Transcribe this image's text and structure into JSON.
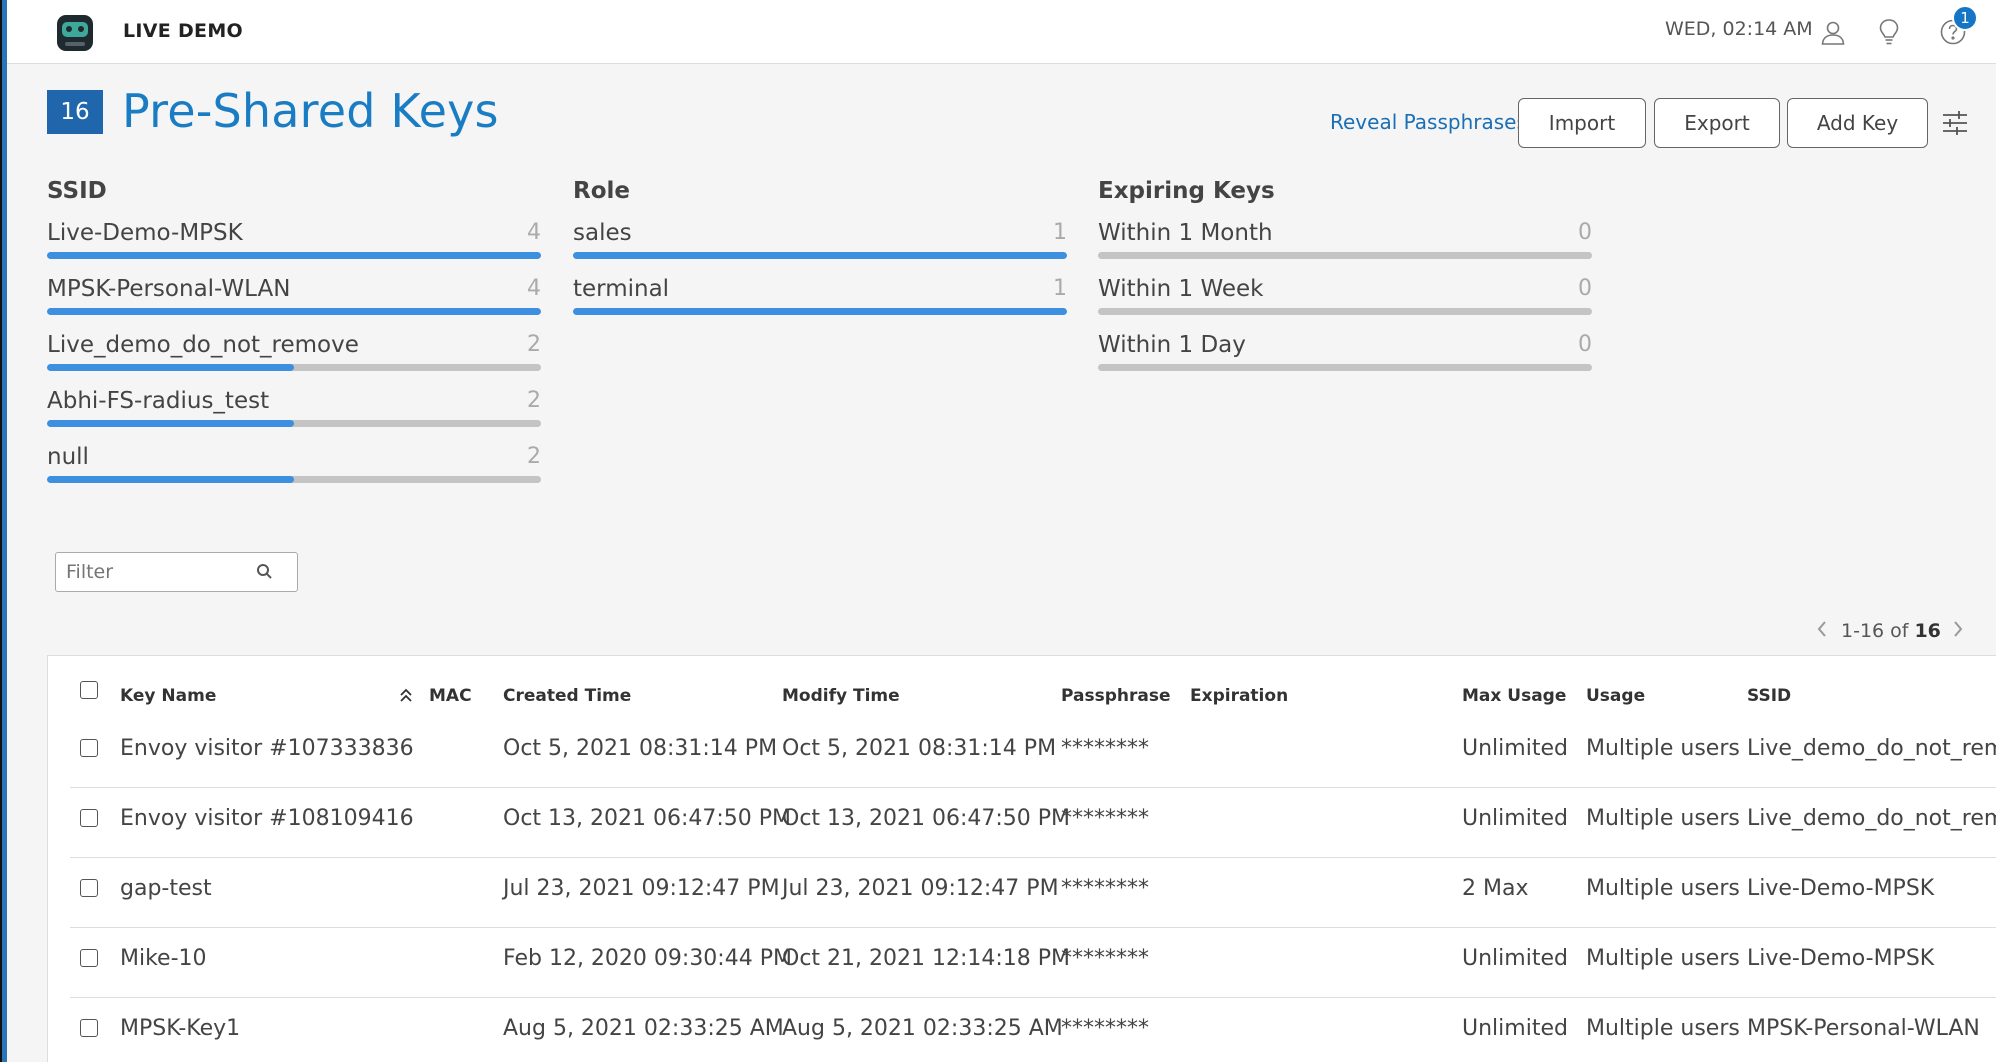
{
  "header": {
    "app_name": "LIVE DEMO",
    "clock": "WED, 02:14 AM",
    "notification_count": "1"
  },
  "page": {
    "count": "16",
    "title": "Pre-Shared Keys",
    "reveal_label": "Reveal Passphrases",
    "import_label": "Import",
    "export_label": "Export",
    "add_key_label": "Add Key"
  },
  "summary": {
    "ssid": {
      "title": "SSID",
      "items": [
        {
          "label": "Live-Demo-MPSK",
          "count": "4",
          "fraction": 1.0
        },
        {
          "label": "MPSK-Personal-WLAN",
          "count": "4",
          "fraction": 1.0
        },
        {
          "label": "Live_demo_do_not_remove",
          "count": "2",
          "fraction": 0.5
        },
        {
          "label": "Abhi-FS-radius_test",
          "count": "2",
          "fraction": 0.5
        },
        {
          "label": "null",
          "count": "2",
          "fraction": 0.5
        }
      ]
    },
    "role": {
      "title": "Role",
      "items": [
        {
          "label": "sales",
          "count": "1",
          "fraction": 1.0
        },
        {
          "label": "terminal",
          "count": "1",
          "fraction": 1.0
        }
      ]
    },
    "expiring": {
      "title": "Expiring Keys",
      "items": [
        {
          "label": "Within 1 Month",
          "count": "0",
          "fraction": 0
        },
        {
          "label": "Within 1 Week",
          "count": "0",
          "fraction": 0
        },
        {
          "label": "Within 1 Day",
          "count": "0",
          "fraction": 0
        }
      ]
    }
  },
  "filter": {
    "placeholder": "Filter"
  },
  "pager": {
    "range": "1-16",
    "of": "of",
    "total": "16"
  },
  "table": {
    "columns": {
      "key_name": "Key Name",
      "mac": "MAC",
      "created": "Created Time",
      "modify": "Modify Time",
      "passphrase": "Passphrase",
      "expiration": "Expiration",
      "max_usage": "Max Usage",
      "usage": "Usage",
      "ssid": "SSID"
    },
    "rows": [
      {
        "key_name": "Envoy visitor #107333836",
        "mac": "",
        "created": "Oct 5, 2021 08:31:14 PM",
        "modify": "Oct 5, 2021 08:31:14 PM",
        "passphrase": "********",
        "expiration": "",
        "max_usage": "Unlimited",
        "usage": "Multiple users",
        "ssid": "Live_demo_do_not_remove"
      },
      {
        "key_name": "Envoy visitor #108109416",
        "mac": "",
        "created": "Oct 13, 2021 06:47:50 PM",
        "modify": "Oct 13, 2021 06:47:50 PM",
        "passphrase": "********",
        "expiration": "",
        "max_usage": "Unlimited",
        "usage": "Multiple users",
        "ssid": "Live_demo_do_not_remove"
      },
      {
        "key_name": "gap-test",
        "mac": "",
        "created": "Jul 23, 2021 09:12:47 PM",
        "modify": "Jul 23, 2021 09:12:47 PM",
        "passphrase": "********",
        "expiration": "",
        "max_usage": "2 Max",
        "usage": "Multiple users",
        "ssid": "Live-Demo-MPSK"
      },
      {
        "key_name": "Mike-10",
        "mac": "",
        "created": "Feb 12, 2020 09:30:44 PM",
        "modify": "Oct 21, 2021 12:14:18 PM",
        "passphrase": "********",
        "expiration": "",
        "max_usage": "Unlimited",
        "usage": "Multiple users",
        "ssid": "Live-Demo-MPSK"
      },
      {
        "key_name": "MPSK-Key1",
        "mac": "",
        "created": "Aug 5, 2021 02:33:25 AM",
        "modify": "Aug 5, 2021 02:33:25 AM",
        "passphrase": "********",
        "expiration": "",
        "max_usage": "Unlimited",
        "usage": "Multiple users",
        "ssid": "MPSK-Personal-WLAN"
      }
    ]
  },
  "colors": {
    "accent": "#1a7dc4",
    "bar_fill": "#3d8fe0",
    "bar_track": "#c4c4c4",
    "badge": "#1576c6"
  }
}
